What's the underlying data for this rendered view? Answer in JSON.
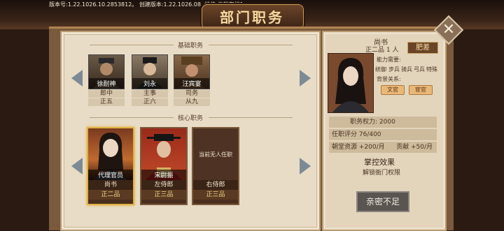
{
  "version_text": "版本号:1.22.1026.10.2853812。 创建版本:1.22.1026.08, 档位:云端存档1",
  "title": "部门职务",
  "basic_section": "基础职务",
  "core_section": "核心职务",
  "basic_posts": [
    {
      "name": "徐耐神",
      "position": "郎中",
      "rank": "正五"
    },
    {
      "name": "刘永",
      "position": "主事",
      "rank": "正六"
    },
    {
      "name": "汪宾宴",
      "position": "司务",
      "rank": "从九"
    }
  ],
  "core_posts": [
    {
      "name": "代理官员",
      "position": "尚书",
      "rank": "正二品",
      "empty": false,
      "selected": true
    },
    {
      "name": "宋尉振",
      "position": "左侍郎",
      "rank": "正三品",
      "empty": false,
      "selected": false
    },
    {
      "name": "",
      "empty_text": "当前无人任职",
      "position": "右侍郎",
      "rank": "正三品",
      "empty": true,
      "selected": false
    }
  ],
  "detail": {
    "title": "尚书",
    "subtitle": "正二品 1 人",
    "badge": "肥差",
    "ability_label": "能力需要:",
    "abilities": [
      "统御",
      "步兵",
      "骑兵",
      "弓兵",
      "特殊"
    ],
    "background_label": "背景关系:",
    "backgrounds": [
      "文官",
      "宦官"
    ],
    "power": "职务权力: 2000",
    "evaluation": "任职评分 76/400",
    "resource": "朝堂资源 +200/月",
    "contribution": "贡献 +50/月",
    "control_title": "掌控效果",
    "control_desc": "解锁衙门权限",
    "intimacy_button": "亲密不足"
  }
}
